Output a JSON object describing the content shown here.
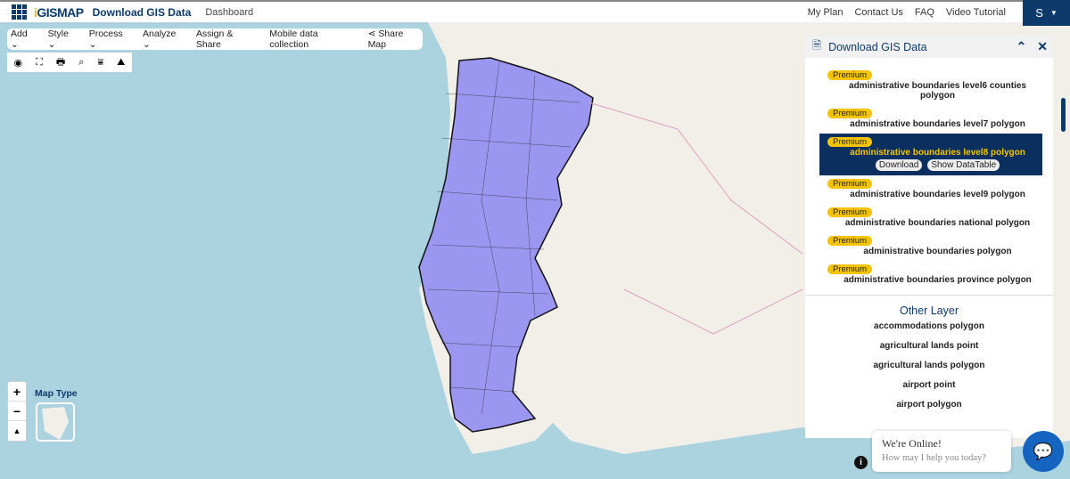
{
  "header": {
    "logo": "iGISMAP",
    "title": "Download GIS Data",
    "dashboard": "Dashboard",
    "nav": [
      "My Plan",
      "Contact Us",
      "FAQ",
      "Video Tutorial"
    ],
    "user_initial": "S"
  },
  "toolbar": {
    "menus": [
      "Add",
      "Style",
      "Process",
      "Analyze"
    ],
    "assign": "Assign & Share",
    "mobile": "Mobile data collection",
    "share": "Share Map"
  },
  "map": {
    "map_type_label": "Map Type",
    "zoom_in": "+",
    "zoom_out": "−",
    "north": "▲"
  },
  "panel": {
    "title": "Download GIS Data",
    "premium_label": "Premium",
    "items": [
      "administrative boundaries level6 counties polygon",
      "administrative boundaries level7 polygon",
      "administrative boundaries level8 polygon",
      "administrative boundaries level9 polygon",
      "administrative boundaries national polygon",
      "administrative boundaries polygon",
      "administrative boundaries province polygon"
    ],
    "download": "Download",
    "show_table": "Show DataTable",
    "other_title": "Other Layer",
    "other": [
      "accommodations polygon",
      "agricultural lands point",
      "agricultural lands polygon",
      "airport point",
      "airport polygon"
    ]
  },
  "chat": {
    "title": "We're Online!",
    "subtitle": "How may I help you today?"
  },
  "colors": {
    "brand": "#0d3a6b",
    "premium": "#f5c400",
    "polygon": "#9b97f0",
    "sea": "#aad3df",
    "land": "#f2efe9"
  }
}
